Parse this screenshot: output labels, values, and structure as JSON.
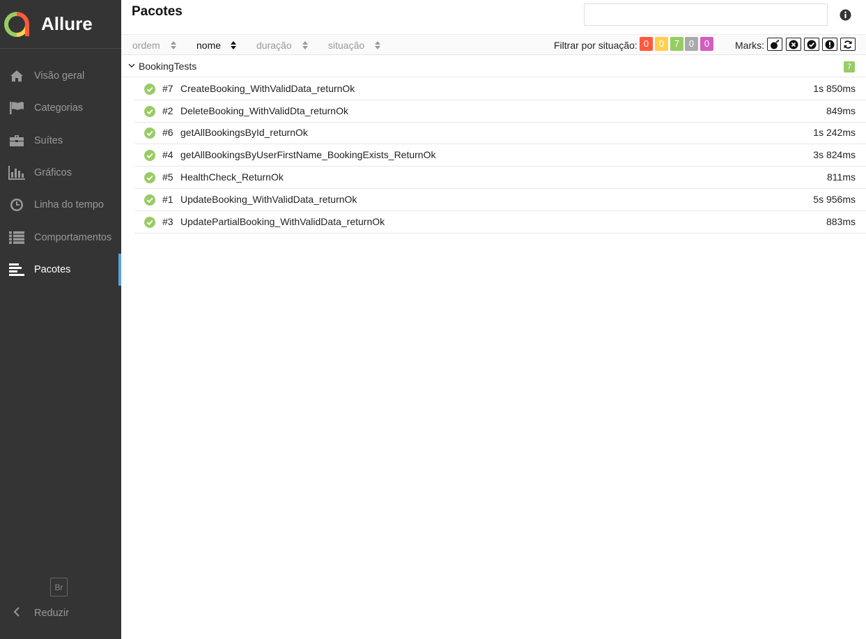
{
  "app": {
    "name": "Allure"
  },
  "sidebar": {
    "items": [
      {
        "label": "Visão geral",
        "icon": "home-icon"
      },
      {
        "label": "Categorias",
        "icon": "flag-icon"
      },
      {
        "label": "Suítes",
        "icon": "briefcase-icon"
      },
      {
        "label": "Gráficos",
        "icon": "bar-chart-icon"
      },
      {
        "label": "Linha do tempo",
        "icon": "clock-icon"
      },
      {
        "label": "Comportamentos",
        "icon": "list-icon"
      },
      {
        "label": "Pacotes",
        "icon": "align-left-icon",
        "active": true
      }
    ],
    "language": "Br",
    "collapse_label": "Reduzir"
  },
  "header": {
    "title": "Pacotes",
    "search_placeholder": ""
  },
  "toolbar": {
    "sorters": [
      {
        "label": "ordem"
      },
      {
        "label": "nome",
        "active": true
      },
      {
        "label": "duração"
      },
      {
        "label": "situação"
      }
    ],
    "filter_label": "Filtrar por situação:",
    "status_badges": [
      {
        "status": "failed",
        "count": "0",
        "color": "#fd5a3e"
      },
      {
        "status": "broken",
        "count": "0",
        "color": "#ffd050"
      },
      {
        "status": "passed",
        "count": "7",
        "color": "#97cc64"
      },
      {
        "status": "skipped",
        "count": "0",
        "color": "#aaaaaa"
      },
      {
        "status": "unknown",
        "count": "0",
        "color": "#d35ebe"
      }
    ],
    "marks_label": "Marks:",
    "marks": [
      "bomb-icon",
      "times-circle-icon",
      "check-circle-icon",
      "exclamation-circle-icon",
      "refresh-icon"
    ]
  },
  "tree": {
    "group": {
      "name": "BookingTests",
      "count": "7"
    },
    "tests": [
      {
        "order": "#7",
        "name": "CreateBooking_WithValidData_returnOk",
        "duration": "1s 850ms",
        "status": "passed"
      },
      {
        "order": "#2",
        "name": "DeleteBooking_WithValidDta_returnOk",
        "duration": "849ms",
        "status": "passed"
      },
      {
        "order": "#6",
        "name": "getAllBookingsById_returnOk",
        "duration": "1s 242ms",
        "status": "passed"
      },
      {
        "order": "#4",
        "name": "getAllBookingsByUserFirstName_BookingExists_ReturnOk",
        "duration": "3s 824ms",
        "status": "passed"
      },
      {
        "order": "#5",
        "name": "HealthCheck_ReturnOk",
        "duration": "811ms",
        "status": "passed"
      },
      {
        "order": "#1",
        "name": "UpdateBooking_WithValidData_returnOk",
        "duration": "5s 956ms",
        "status": "passed"
      },
      {
        "order": "#3",
        "name": "UpdatePartialBooking_WithValidData_returnOk",
        "duration": "883ms",
        "status": "passed"
      }
    ]
  },
  "colors": {
    "sidebar_bg": "#343434",
    "accent": "#5aa3e0",
    "passed": "#97cc64"
  }
}
